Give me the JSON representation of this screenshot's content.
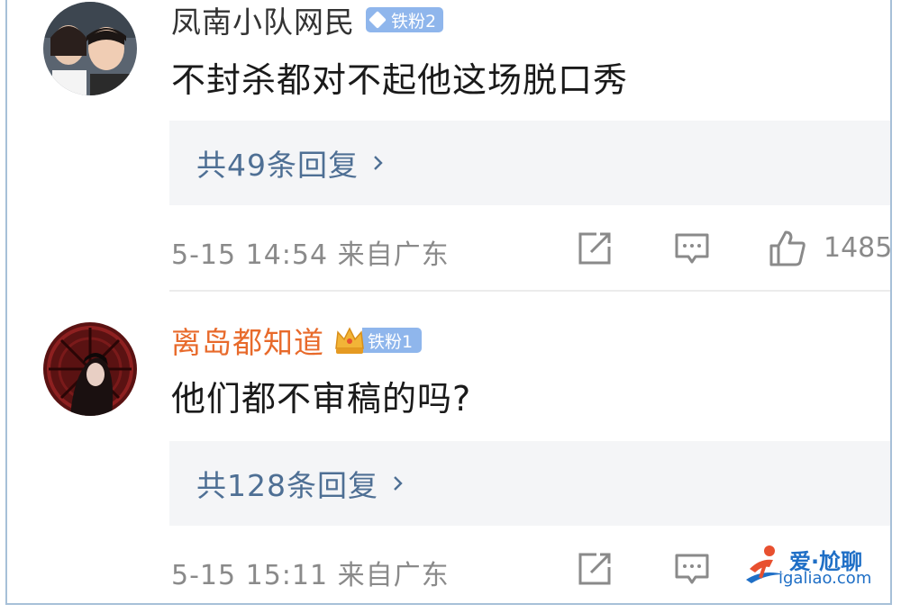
{
  "comments": [
    {
      "username": "凤南小队网民",
      "badge": "铁粉2",
      "text": "不封杀都对不起他这场脱口秀",
      "replies": "共49条回复",
      "meta": "5-15 14:54 来自广东",
      "likes": "1485"
    },
    {
      "username": "离岛都知道",
      "badge": "铁粉1",
      "text": "他们都不审稿的吗?",
      "replies": "共128条回复",
      "meta": "5-15 15:11 来自广东"
    }
  ],
  "watermark": {
    "title": "爱·尬聊",
    "url": "igaliao.com"
  },
  "colors": {
    "reply_link": "#4e6f94",
    "vip_name": "#e86a2b",
    "badge": "#8fb6ec",
    "meta": "#8a8a8a"
  },
  "icons": [
    "avatar-photo",
    "diamond-icon",
    "crown-icon",
    "chevron-right-icon",
    "share-icon",
    "comment-icon",
    "thumbs-up-icon"
  ]
}
